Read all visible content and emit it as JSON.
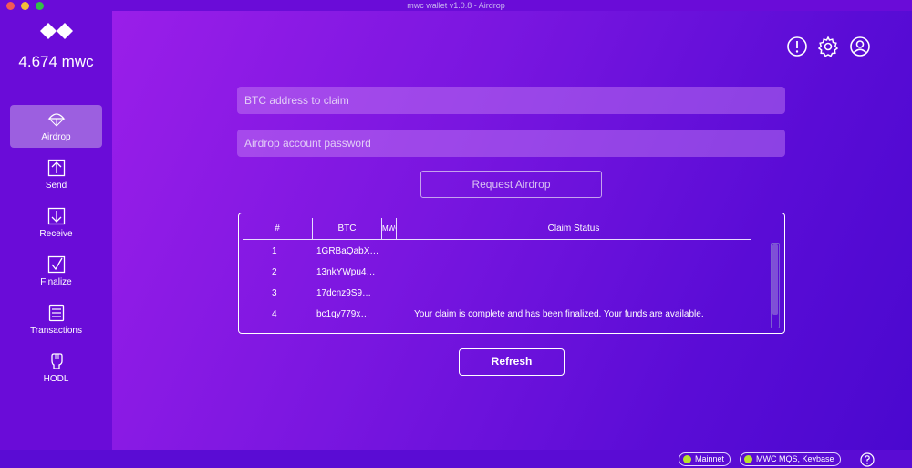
{
  "window": {
    "title": "mwc wallet v1.0.8 - Airdrop"
  },
  "sidebar": {
    "logo_icon": "mwc-logo-icon",
    "balance": "4.674 mwc",
    "items": [
      {
        "label": "Airdrop",
        "icon": "parachute-icon",
        "active": true
      },
      {
        "label": "Send",
        "icon": "arrow-up-icon",
        "active": false
      },
      {
        "label": "Receive",
        "icon": "arrow-down-icon",
        "active": false
      },
      {
        "label": "Finalize",
        "icon": "checkmark-icon",
        "active": false
      },
      {
        "label": "Transactions",
        "icon": "list-icon",
        "active": false
      },
      {
        "label": "HODL",
        "icon": "fist-icon",
        "active": false
      }
    ]
  },
  "header": {
    "icons": [
      "alert-icon",
      "gear-icon",
      "user-icon"
    ]
  },
  "form": {
    "btc_address_placeholder": "BTC address to claim",
    "password_placeholder": "Airdrop account password",
    "request_button": "Request Airdrop"
  },
  "table": {
    "columns": [
      "#",
      "BTC",
      "MWC",
      "Claim Status"
    ],
    "rows": [
      {
        "num": "1",
        "btc": "1GRBaQabX…",
        "mwc": "",
        "status": ""
      },
      {
        "num": "2",
        "btc": "13nkYWpu4…",
        "mwc": "",
        "status": ""
      },
      {
        "num": "3",
        "btc": "17dcnz9S9…",
        "mwc": "",
        "status": ""
      },
      {
        "num": "4",
        "btc": "bc1qy779x…",
        "mwc": "",
        "status": "Your claim is complete and has been finalized. Your funds are available."
      }
    ]
  },
  "refresh_button": "Refresh",
  "statusbar": {
    "network": "Mainnet",
    "services": "MWC MQS, Keybase",
    "status_color": "#b7e22d",
    "help_icon": "question-icon"
  },
  "colors": {
    "background": "#6a0cd8",
    "accent": "#9c5fe0"
  }
}
